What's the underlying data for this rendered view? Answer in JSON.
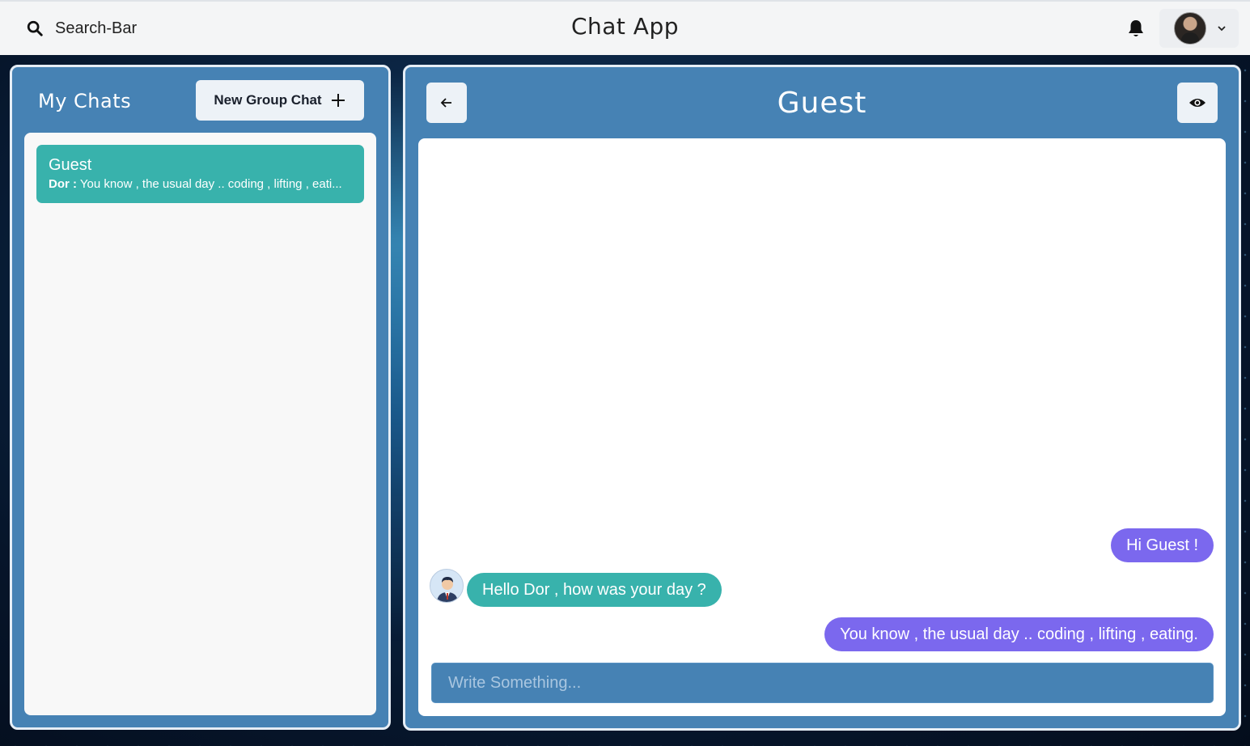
{
  "header": {
    "search_label": "Search-Bar",
    "app_title": "Chat App",
    "icons": {
      "search": "search-icon",
      "notifications": "bell-icon",
      "profile_menu": "chevron-down-icon"
    }
  },
  "sidebar": {
    "title": "My Chats",
    "new_group_label": "New Group Chat",
    "chats": [
      {
        "name": "Guest",
        "last_sender": "Dor :",
        "last_message": "You know , the usual day .. coding , lifting , eati..."
      }
    ]
  },
  "chat": {
    "title": "Guest",
    "messages": [
      {
        "direction": "outgoing",
        "text": "Hi Guest !"
      },
      {
        "direction": "incoming",
        "text": "Hello Dor , how was your day ?"
      },
      {
        "direction": "outgoing",
        "text": "You know , the usual day .. coding , lifting , eating."
      }
    ],
    "input_placeholder": "Write Something..."
  },
  "colors": {
    "panel": "#4682b4",
    "incoming_bubble": "#38b2ac",
    "outgoing_bubble": "#7b68ee",
    "topbar": "#f4f5f6"
  }
}
